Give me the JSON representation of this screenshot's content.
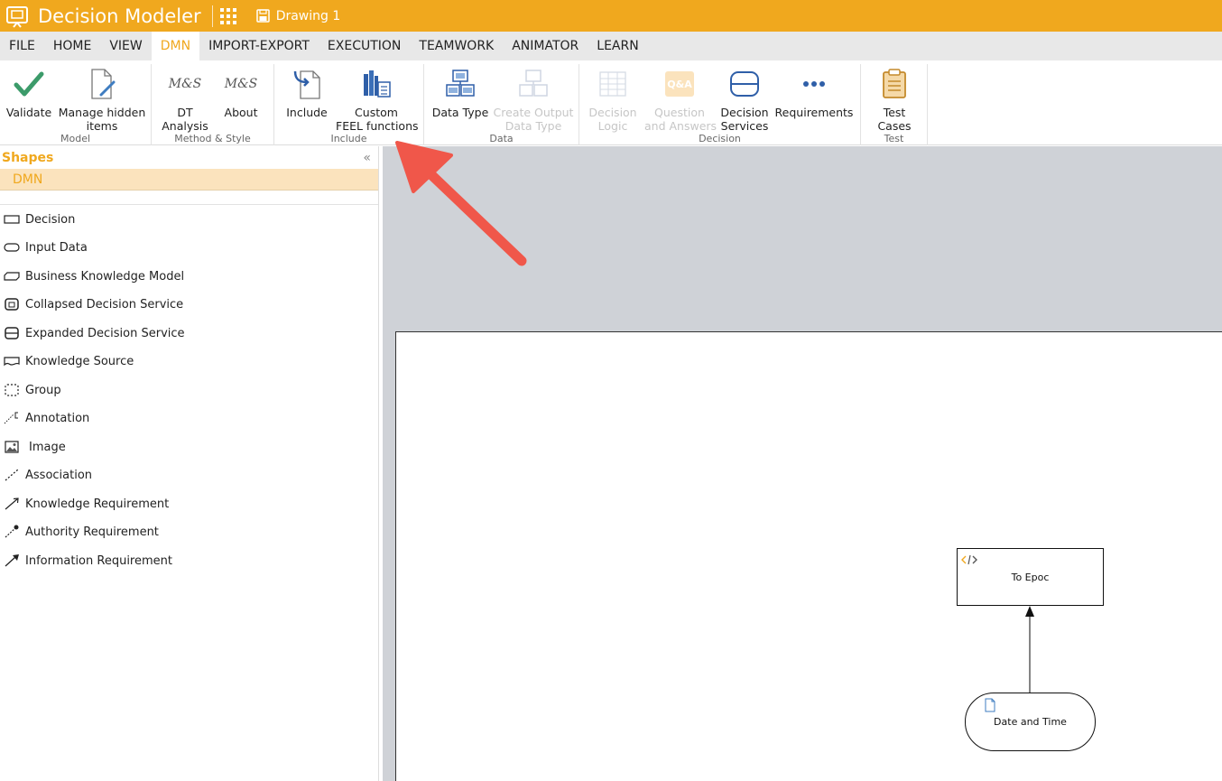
{
  "app": {
    "title": "Decision Modeler",
    "document": "Drawing 1",
    "accent": "#f0a81e"
  },
  "menu": [
    "FILE",
    "HOME",
    "VIEW",
    "DMN",
    "IMPORT-EXPORT",
    "EXECUTION",
    "TEAMWORK",
    "ANIMATOR",
    "LEARN"
  ],
  "menu_active": "DMN",
  "ribbon": {
    "model": {
      "label": "Model",
      "validate": "Validate",
      "manage1": "Manage hidden",
      "manage2": "items"
    },
    "method": {
      "label": "Method & Style",
      "ms_logo": "M&S",
      "dt1": "DT",
      "dt2": "Analysis",
      "about": "About"
    },
    "include": {
      "label": "Include",
      "include": "Include",
      "feel1": "Custom",
      "feel2": "FEEL functions"
    },
    "data": {
      "label": "Data",
      "datatype": "Data Type",
      "output1": "Create Output",
      "output2": "Data Type"
    },
    "decision": {
      "label": "Decision",
      "logic1": "Decision",
      "logic2": "Logic",
      "qa_logo": "Q&A",
      "qa1": "Question",
      "qa2": "and Answers",
      "svc1": "Decision",
      "svc2": "Services",
      "req": "Requirements"
    },
    "test": {
      "label": "Test",
      "cases1": "Test",
      "cases2": "Cases"
    }
  },
  "shapes": {
    "title": "Shapes",
    "collapse": "«",
    "section": "DMN",
    "items": [
      "Decision",
      "Input Data",
      "Business Knowledge Model",
      "Collapsed Decision Service",
      "Expanded Decision Service",
      "Knowledge Source",
      "Group",
      "Annotation",
      "Image",
      "Association",
      "Knowledge Requirement",
      "Authority Requirement",
      "Information Requirement"
    ]
  },
  "diagram": {
    "decision_node": "To Epoc",
    "input_node": "Date and Time",
    "arrow_color": "#f0574a"
  }
}
